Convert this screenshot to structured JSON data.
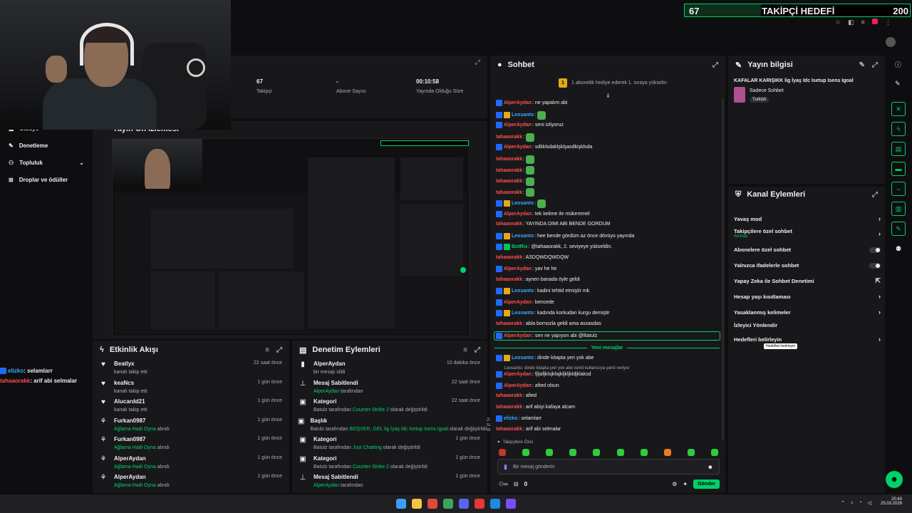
{
  "overlay": {
    "current": "67",
    "label": "TAKİPÇİ HEDEFİ",
    "target": "200",
    "fill_fraction": 0.34
  },
  "stats": [
    {
      "value": "67",
      "label": "Takipçi"
    },
    {
      "value": "-",
      "label": "Abone Sayısı"
    },
    {
      "value": "00:10:58",
      "label": "Yayında Olduğu Süre"
    }
  ],
  "preview": {
    "label": "Yayın Ön İzlemesi"
  },
  "sidebar": {
    "items": [
      {
        "label": "Stüdyo",
        "icon": "camera-icon"
      },
      {
        "label": "Denetleme",
        "icon": "wrench-icon"
      },
      {
        "label": "Topluluk",
        "icon": "people-icon"
      },
      {
        "label": "Droplar ve ödüller",
        "icon": "gift-icon"
      }
    ]
  },
  "side_chat": [
    {
      "user": "elizko",
      "text": ": selamlarr"
    },
    {
      "user": "tahaaorakk",
      "text": ": arif abi selmalar"
    }
  ],
  "activity": {
    "title": "Etkinlik Akışı",
    "items": [
      {
        "name": "Beatlyx",
        "desc": "kanalı takip etti",
        "time": "22 saat önce",
        "icon": "heart-icon"
      },
      {
        "name": "keaNcs",
        "desc": "kanalı takip etti",
        "time": "1 gün önce",
        "icon": "heart-icon"
      },
      {
        "name": "Alucardd21",
        "desc": "kanalı takip etti",
        "time": "1 gün önce",
        "icon": "heart-icon"
      },
      {
        "name": "Furkan0987",
        "desc_green": "Ağlama Hadi Oyna",
        "desc": "alındı",
        "time": "1 gün önce",
        "icon": "reward-icon"
      },
      {
        "name": "Furkan0987",
        "desc_green": "Ağlama Hadi Oyna",
        "desc": "alındı",
        "time": "1 gün önce",
        "icon": "reward-icon"
      },
      {
        "name": "AlperAydan",
        "desc_green": "Ağlama Hadi Oyna",
        "desc": "alındı",
        "time": "1 gün önce",
        "icon": "reward-icon"
      },
      {
        "name": "AlperAydan",
        "desc_green": "Ağlama Hadi Oyna",
        "desc": "alındı",
        "time": "1 gün önce",
        "icon": "reward-icon"
      }
    ]
  },
  "moderation": {
    "title": "Denetim Eylemleri",
    "items": [
      {
        "name": "AlperAydan",
        "pre": "",
        "green": "",
        "desc": "bir mesajı sildi",
        "time": "10 dakika önce",
        "icon": "trash-icon"
      },
      {
        "name": "Mesaj Sabitlendi",
        "pre": "",
        "green": "AlperAydan",
        "desc": "tarafından",
        "time": "22 saat önce",
        "icon": "pin-icon"
      },
      {
        "name": "Kategori",
        "pre": "Batulz",
        "green": "Counter-Strike 2",
        "desc": "olarak değiştirildi",
        "time": "22 saat önce",
        "icon": "edit-icon"
      },
      {
        "name": "Başlık",
        "pre": "Batulz",
        "green": "BOŞVER, GEL lig İyaş Idc Isetup Isens Igoal",
        "desc": "olarak değiştirildi",
        "time": "23 saat önce",
        "icon": "edit-icon"
      },
      {
        "name": "Kategori",
        "pre": "Batulz",
        "green": "Just Chatting",
        "desc": "olarak değiştirildi",
        "time": "1 gün önce",
        "icon": "edit-icon"
      },
      {
        "name": "Kategori",
        "pre": "Batulz",
        "green": "Counter-Strike 2",
        "desc": "olarak değiştirildi",
        "time": "1 gün önce",
        "icon": "edit-icon"
      },
      {
        "name": "Mesaj Sabitlendi",
        "pre": "",
        "green": "AlperAydan",
        "desc": "tarafından",
        "time": "1 gün önce",
        "icon": "pin-icon"
      }
    ]
  },
  "chat": {
    "title": "Sohbet",
    "gift_banner": "1 abonelik hediye ederek 1. sıraya yükselin",
    "gift_rank": "1",
    "new_messages": "Yeni mesajlar",
    "reply_hint": "Leosanto: dinde kitapta yeri yok abe isimli kullanıcıya yanıt veriyor",
    "followers_only": "Takipçilere Özel",
    "input_placeholder": "Bir mesaj gönderin",
    "send_label": "Gönder",
    "points": "0",
    "messages": [
      {
        "user": "AlperAydan",
        "color": "red",
        "badges": [
          "blue"
        ],
        "text": ": ne yapalım abi"
      },
      {
        "user": "Leosanto",
        "color": "blue",
        "badges": [
          "blue",
          "gold"
        ],
        "text": ":",
        "emote": true
      },
      {
        "user": "AlperAydan",
        "color": "red",
        "badges": [
          "blue"
        ],
        "text": ": seni izliyoruz"
      },
      {
        "user": "tahaaorakk",
        "color": "red",
        "badges": [],
        "text": ":",
        "emote": true
      },
      {
        "user": "AlperAydan",
        "color": "red",
        "badges": [
          "blue"
        ],
        "text": ": sdkklsdaklşklşasdkişklsda"
      },
      {
        "user": "tahaaorakk",
        "color": "red",
        "badges": [],
        "text": ":",
        "emote": true
      },
      {
        "user": "tahaaorakk",
        "color": "red",
        "badges": [],
        "text": ":",
        "emote": true
      },
      {
        "user": "tahaaorakk",
        "color": "red",
        "badges": [],
        "text": ":",
        "emote": true
      },
      {
        "user": "tahaaorakk",
        "color": "red",
        "badges": [],
        "text": ":",
        "emote": true
      },
      {
        "user": "Leosanto",
        "color": "blue",
        "badges": [
          "blue",
          "gold"
        ],
        "text": ":",
        "emote": true
      },
      {
        "user": "AlperAydan",
        "color": "red",
        "badges": [
          "blue"
        ],
        "text": ": tek kelime ile mükemmel"
      },
      {
        "user": "tahaaorakk",
        "color": "red",
        "badges": [],
        "text": ": YAYINDA DIMI ABI BENDE GORDUM"
      },
      {
        "user": "Leosanto",
        "color": "blue",
        "badges": [
          "blue",
          "gold"
        ],
        "text": ": hee bende gördüm az önce dövüyo yayında"
      },
      {
        "user": "BotRix",
        "color": "green",
        "badges": [
          "blue",
          "green"
        ],
        "text": ": @tahaaorakk, 2. seviyeye yükseldin."
      },
      {
        "user": "tahaaorakk",
        "color": "red",
        "badges": [],
        "text": ": ASDQWDQWDQW"
      },
      {
        "user": "AlperAydan",
        "color": "red",
        "badges": [
          "blue"
        ],
        "text": ": yav he he"
      },
      {
        "user": "tahaaorakk",
        "color": "red",
        "badges": [],
        "text": ": aynen banada öyle geldi"
      },
      {
        "user": "Leosanto",
        "color": "blue",
        "badges": [
          "blue",
          "gold"
        ],
        "text": ": kadini tehtid etmiştir mk"
      },
      {
        "user": "AlperAydan",
        "color": "red",
        "badges": [
          "blue"
        ],
        "text": ": bencede"
      },
      {
        "user": "Leosanto",
        "color": "blue",
        "badges": [
          "blue",
          "gold"
        ],
        "text": ": kadında korkudan kurgu demiştir"
      },
      {
        "user": "tahaaorakk",
        "color": "red",
        "badges": [],
        "text": ": abla bornozla geldi ama asxasdas"
      },
      {
        "user": "AlperAydan",
        "color": "red",
        "badges": [
          "blue"
        ],
        "text": ": sen ne yapıyon abi @Batulz",
        "highlight": true
      }
    ],
    "after": [
      {
        "user": "Leosanto",
        "color": "blue",
        "badges": [
          "blue",
          "gold"
        ],
        "text": ": dinde kitapta yeri yok abe"
      },
      {
        "user": "AlperAydan",
        "color": "red",
        "badges": [
          "blue"
        ],
        "text": ": fjljafjklsjkfajkljkljkldjklaksd"
      },
      {
        "user": "AlperAydan",
        "color": "red",
        "badges": [
          "blue"
        ],
        "text": ": afied olsun"
      },
      {
        "user": "tahaaorakk",
        "color": "red",
        "badges": [],
        "text": ": afied"
      },
      {
        "user": "tahaaorakk",
        "color": "red",
        "badges": [],
        "text": ": arif abiyi kafaya alcam"
      },
      {
        "user": "elizko",
        "color": "blue",
        "badges": [
          "blue"
        ],
        "text": ": selamlarr"
      },
      {
        "user": "tahaaorakk",
        "color": "red",
        "badges": [],
        "text": ": arif abi selmalar"
      }
    ]
  },
  "stream_info": {
    "title": "Yayın bilgisi",
    "stream_title": "KAFALAR KARIŞIKK lig İyaş Idc Isetup Isens Igoal",
    "category": "Sadece Sohbet",
    "language": "Turkish"
  },
  "channel_actions": {
    "title": "Kanal Eylemleri",
    "items": [
      {
        "label": "Yavaş mod",
        "control": "chevron"
      },
      {
        "label": "Takipçilere özel sohbet",
        "sub": "Anında",
        "control": "chevron"
      },
      {
        "label": "Abonelere özel sohbet",
        "control": "toggle"
      },
      {
        "label": "Yalnızca ifadelerle sohbet",
        "control": "toggle"
      },
      {
        "label": "Yapay Zeka ile Sohbet Denetimi",
        "control": "external"
      },
      {
        "label": "Hesap yaşı kısıtlaması",
        "control": "chevron"
      },
      {
        "label": "Yasaklanmış kelimeler",
        "control": "chevron"
      },
      {
        "label": "İzleyici Yönlendir",
        "control": "none"
      },
      {
        "label": "Hedefleri belirleyin",
        "control": "chevron"
      }
    ],
    "tooltip": "Hedefleri belirleyin"
  },
  "taskbar": {
    "time": "20:40",
    "date": "25.03.2026"
  },
  "colors": {
    "accent": "#00d26a",
    "bg": "#0e0e10",
    "panel": "#18181b"
  }
}
